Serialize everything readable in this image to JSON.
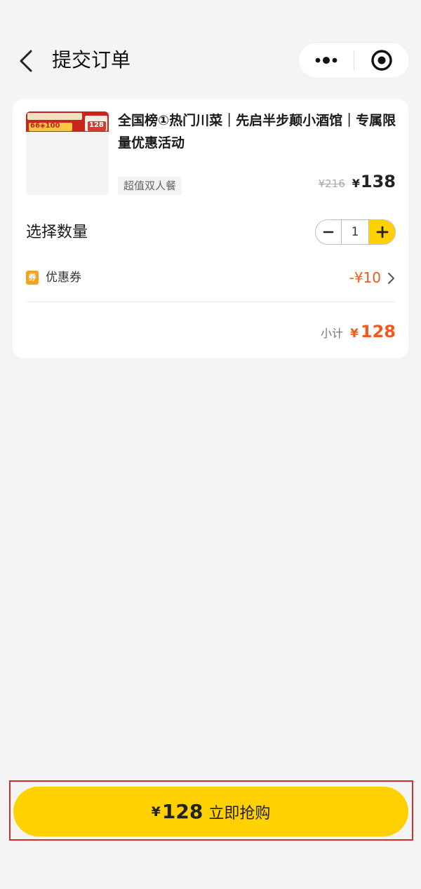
{
  "header": {
    "title": "提交订单",
    "back_icon": "chevron-left-icon",
    "more_icon": "more-dots-icon",
    "close_icon": "target-close-icon"
  },
  "product": {
    "name": "全国榜①热门川菜｜先启半步颠小酒馆｜专属限量优惠活动",
    "tag": "超值双人餐",
    "original_price": "¥216",
    "currency": "¥",
    "price": "138",
    "thumbnail_text_left": "66◈100",
    "thumbnail_text_right": "128"
  },
  "quantity": {
    "label": "选择数量",
    "value": "1",
    "minus_icon": "minus-icon",
    "plus_icon": "plus-icon"
  },
  "coupon": {
    "badge": "券",
    "label": "优惠券",
    "value": "-¥10",
    "arrow_icon": "chevron-right-icon"
  },
  "subtotal": {
    "label": "小计",
    "currency": "¥",
    "amount": "128"
  },
  "buy_button": {
    "currency": "¥",
    "amount": "128",
    "label": "立即抢购"
  },
  "colors": {
    "accent_yellow": "#ffd100",
    "price_orange": "#f05a1b",
    "coupon_badge": "#f7a21b",
    "highlight_red": "#d32f2f"
  }
}
